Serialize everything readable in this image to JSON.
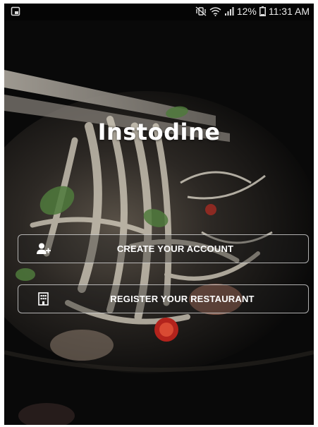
{
  "status_bar": {
    "notification_icon": "screenshot-notification-icon",
    "mute_icon": "vibrate-mute-icon",
    "wifi_icon": "wifi-icon",
    "signal_icon": "signal-icon",
    "battery_percent": "12%",
    "battery_icon": "battery-icon",
    "time": "11:31 AM"
  },
  "app": {
    "title": "Instodine",
    "background": "noodle-bowl-photo"
  },
  "actions": {
    "create_account_label": "CREATE YOUR ACCOUNT",
    "create_account_icon": "add-user-icon",
    "register_restaurant_label": "REGISTER YOUR RESTAURANT",
    "register_restaurant_icon": "building-icon"
  },
  "colors": {
    "background": "#080808",
    "text": "#ffffff",
    "button_border": "#e6e6e6"
  }
}
